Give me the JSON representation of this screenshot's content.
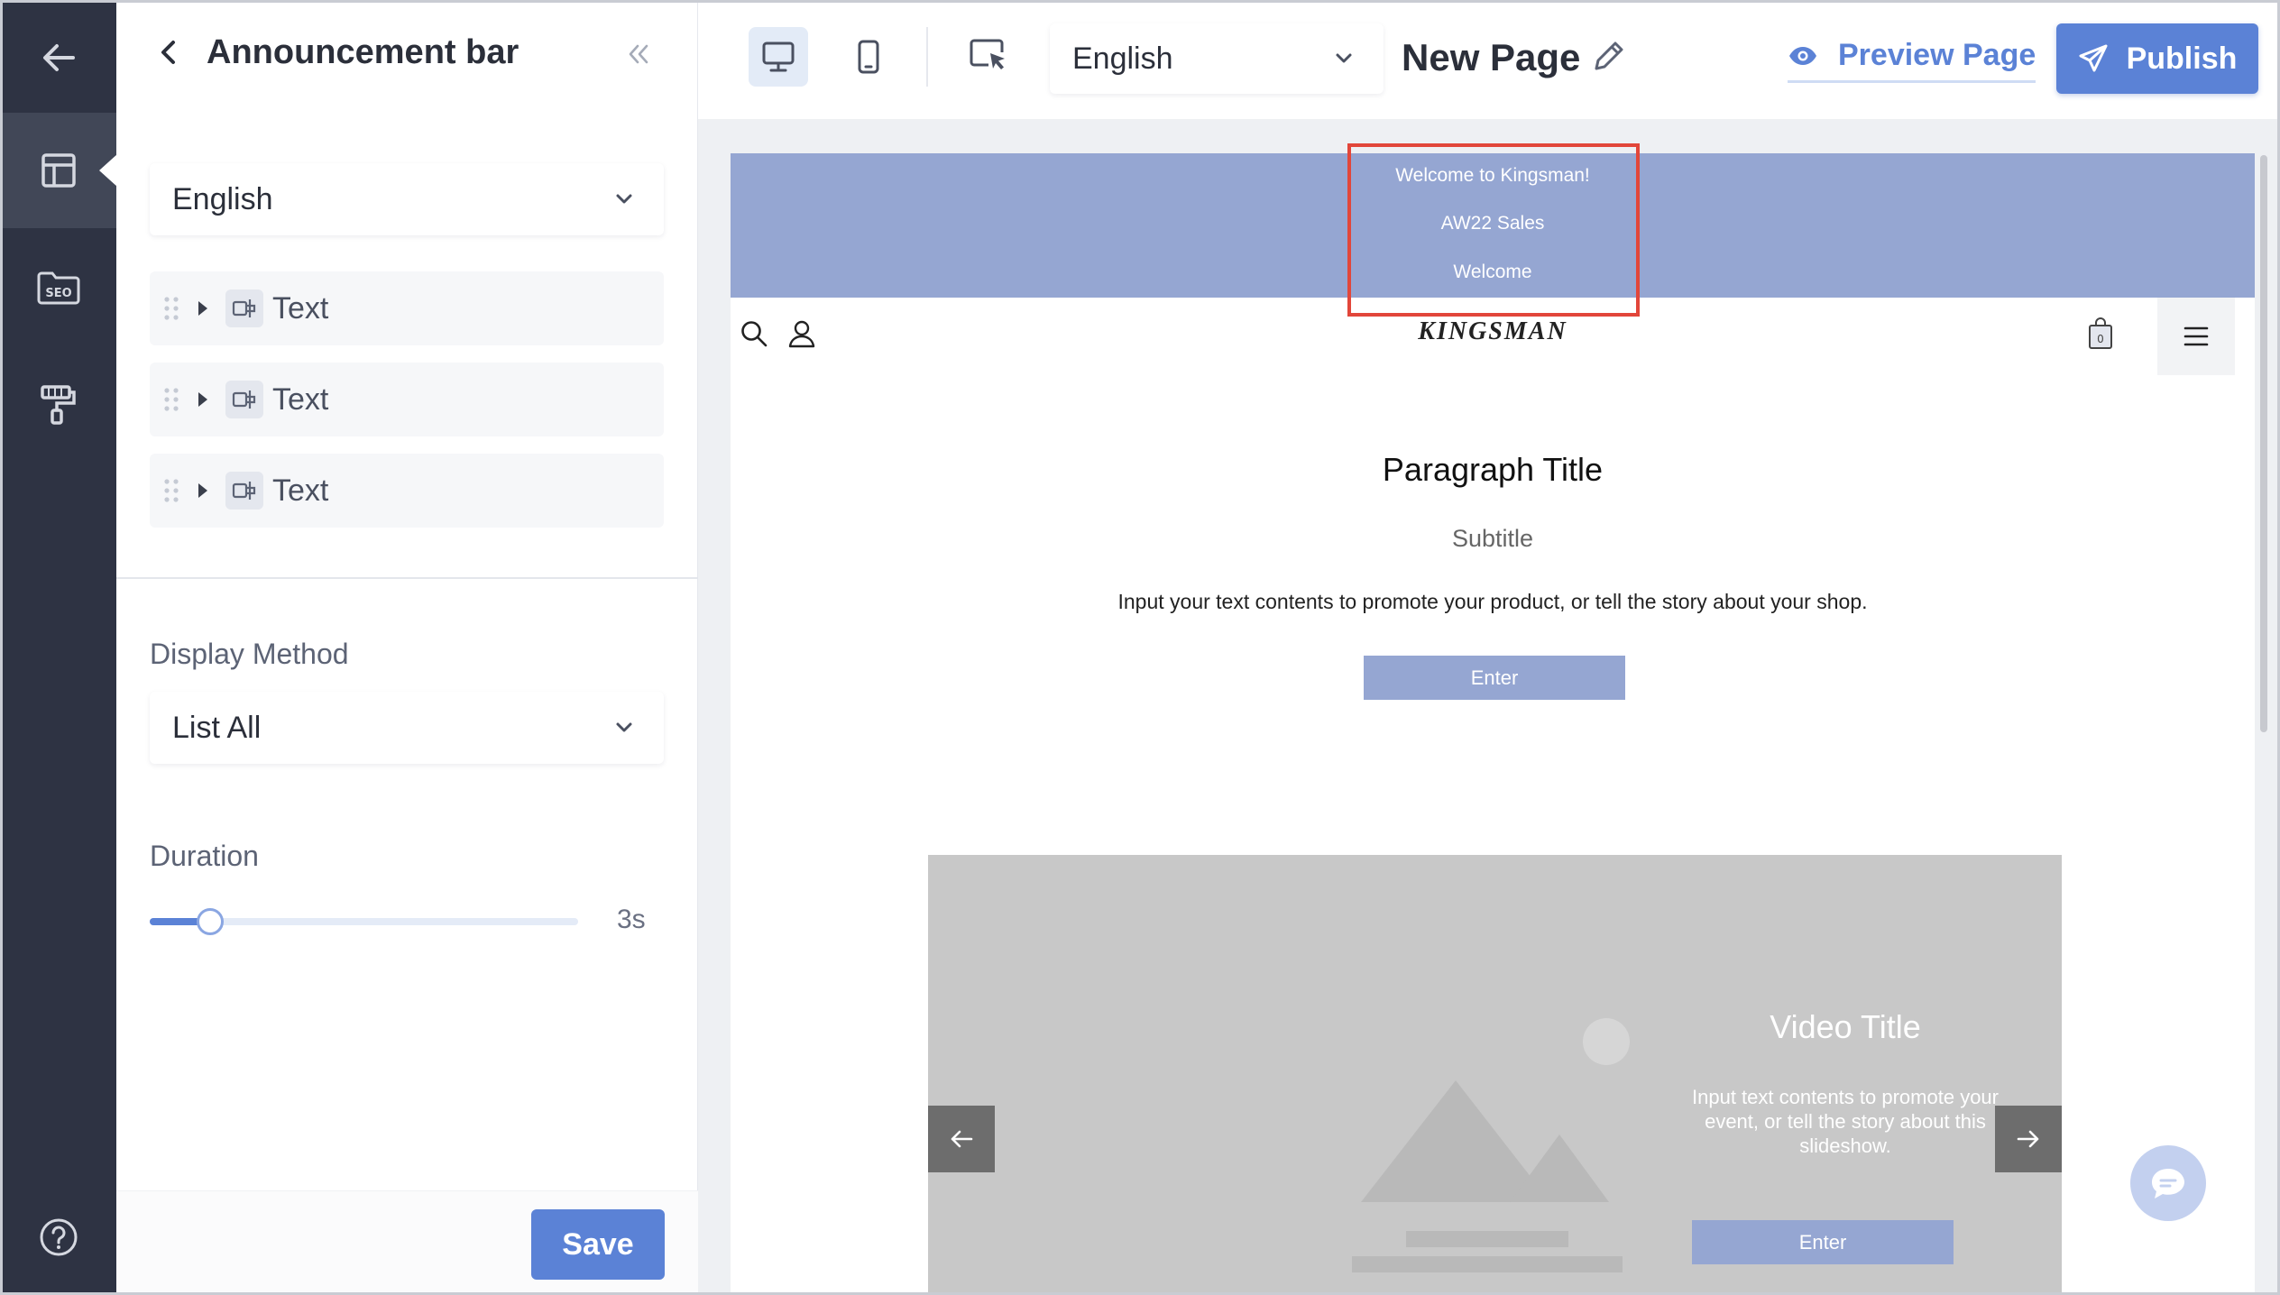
{
  "panel": {
    "title": "Announcement bar",
    "language": "English",
    "text_items": [
      {
        "label": "Text"
      },
      {
        "label": "Text"
      },
      {
        "label": "Text"
      }
    ],
    "display_method": {
      "label": "Display Method",
      "value": "List All"
    },
    "duration": {
      "label": "Duration",
      "value_text": "3s",
      "fill_fraction": 0.14
    },
    "save_label": "Save"
  },
  "toolbar": {
    "language": "English",
    "page_name": "New Page",
    "preview_label": "Preview Page",
    "publish_label": "Publish"
  },
  "site": {
    "announcements": [
      "Welcome to Kingsman!",
      "AW22 Sales",
      "Welcome"
    ],
    "brand": "KINGSMAN",
    "cart_count": "0",
    "paragraph": {
      "title": "Paragraph Title",
      "subtitle": "Subtitle",
      "body": "Input your text contents to promote your product, or tell the story about your shop.",
      "button": "Enter"
    },
    "slideshow": {
      "title": "Video Title",
      "body": "Input text contents to promote your event, or tell the story about this slideshow.",
      "button": "Enter"
    }
  },
  "colors": {
    "accent": "#5b82d6",
    "rail": "#2e3343",
    "announcement_bg": "#95a6d2",
    "highlight": "#e2463a"
  },
  "icons": {
    "rail": [
      "arrow-left-icon",
      "layout-icon",
      "seo-folder-icon",
      "paint-roller-icon",
      "help-icon"
    ],
    "toolbar": [
      "desktop-icon",
      "mobile-icon",
      "cursor-select-icon",
      "pencil-icon",
      "eye-icon",
      "paper-plane-icon"
    ],
    "site": [
      "search-icon",
      "user-icon",
      "shopping-bag-icon",
      "hamburger-menu-icon",
      "arrow-left-icon",
      "arrow-right-icon",
      "chat-icon"
    ]
  }
}
